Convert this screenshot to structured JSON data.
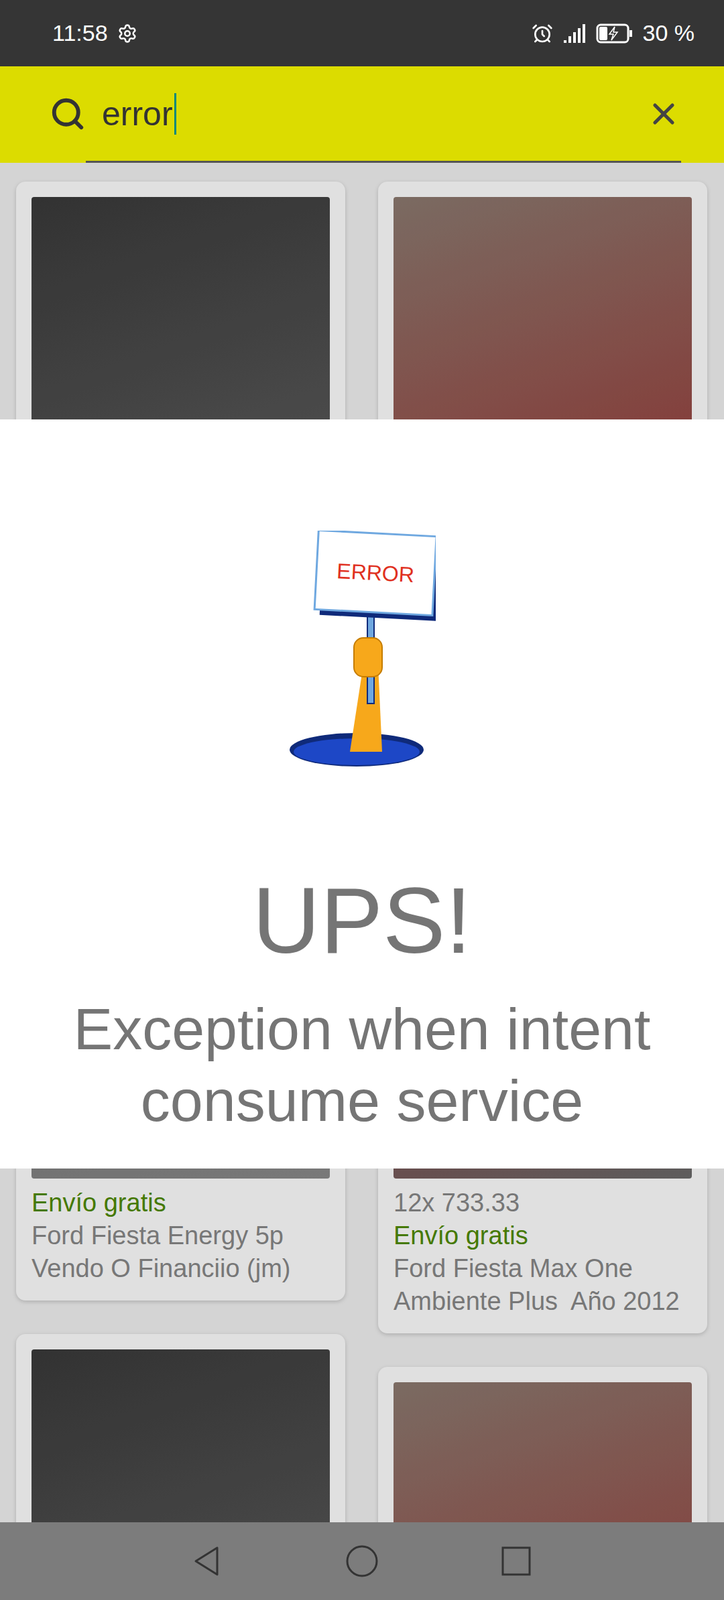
{
  "status_bar": {
    "time": "11:58",
    "battery": {
      "reading": "30 %",
      "level": 0.3,
      "charging": true
    }
  },
  "search": {
    "value": "error"
  },
  "results": [
    {
      "lines": [
        {
          "kind": "shipping",
          "text": "Envío gratis"
        },
        {
          "kind": "title",
          "text": "Ford Fiesta Energy 5p Vendo O Financiio (jm)"
        }
      ]
    },
    {
      "lines": [
        {
          "kind": "installments",
          "text": "12x 733.33"
        },
        {
          "kind": "shipping",
          "text": "Envío gratis"
        },
        {
          "kind": "title",
          "text": "Ford Fiesta Max One Ambiente Plus  Año 2012"
        }
      ]
    },
    {
      "lines": []
    },
    {
      "lines": []
    }
  ],
  "dialog": {
    "sign": "ERROR",
    "title": "UPS!",
    "message": "Exception when intent consume service"
  }
}
